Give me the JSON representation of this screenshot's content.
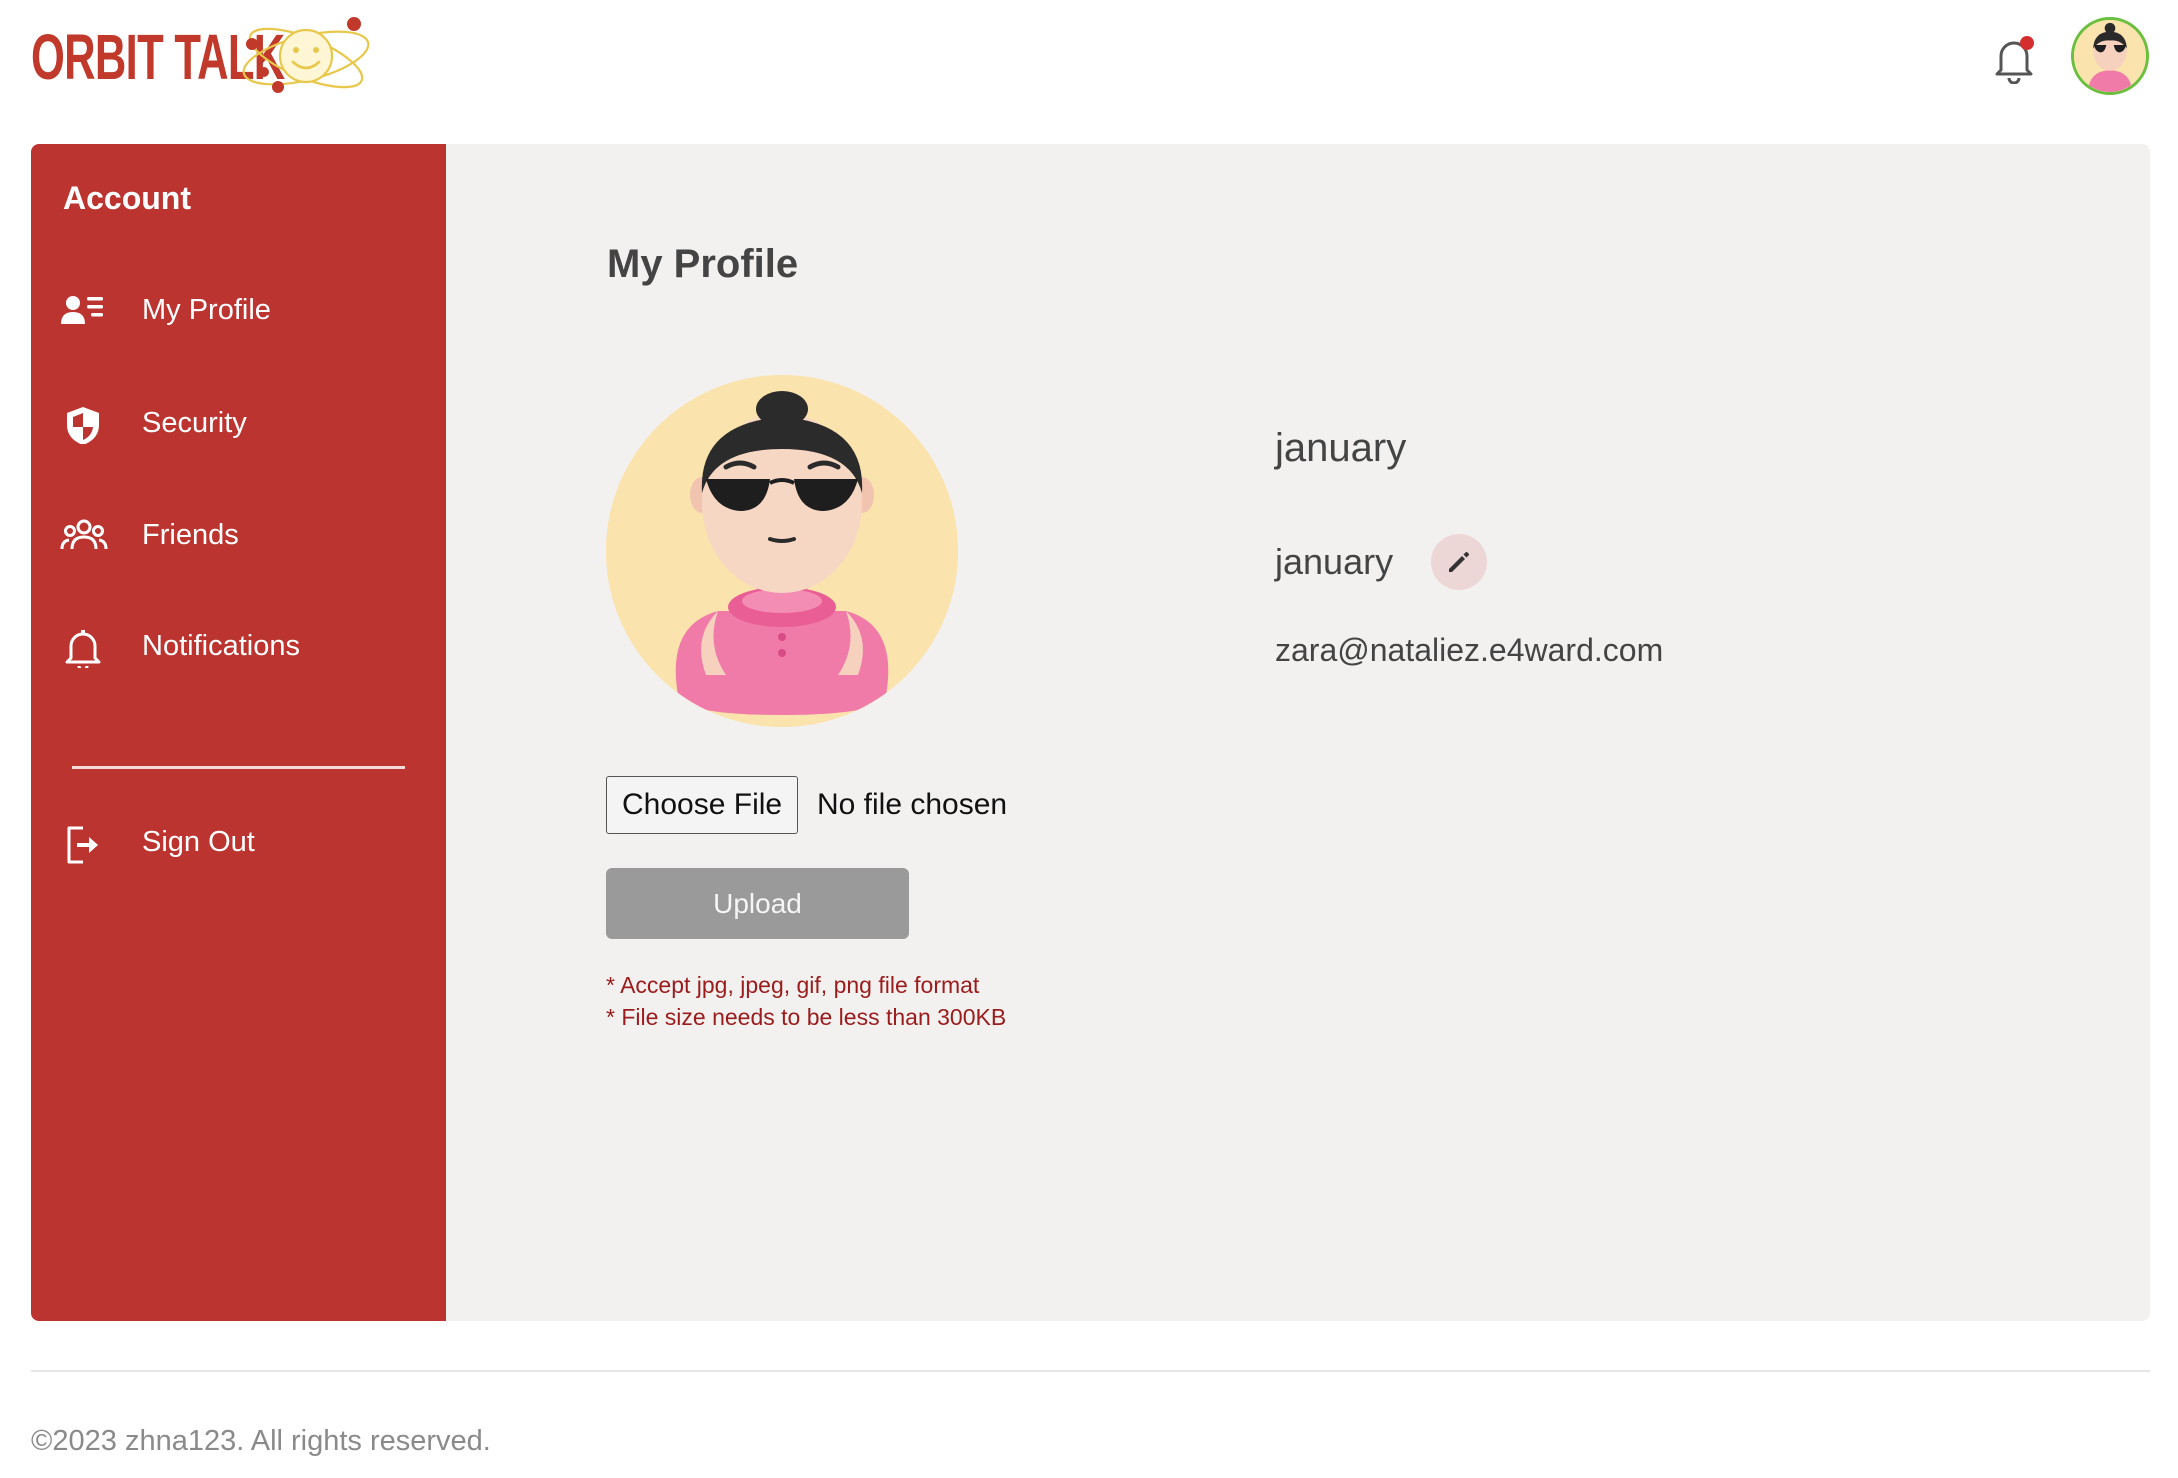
{
  "header": {
    "logo_text": "ORBIT TALK",
    "logo_icon": "smiley-planet-logo-icon",
    "bell_icon": "bell-icon",
    "avatar_icon": "user-avatar"
  },
  "sidebar": {
    "title": "Account",
    "items": [
      {
        "label": "My Profile",
        "icon": "user-list-icon"
      },
      {
        "label": "Security",
        "icon": "shield-icon"
      },
      {
        "label": "Friends",
        "icon": "group-icon"
      },
      {
        "label": "Notifications",
        "icon": "bell-icon"
      }
    ],
    "sign_out": {
      "label": "Sign Out",
      "icon": "sign-out-icon"
    }
  },
  "main": {
    "title": "My Profile",
    "file_input": {
      "button_label": "Choose File",
      "status": "No file chosen"
    },
    "upload_label": "Upload",
    "hints": [
      "* Accept jpg, jpeg, gif, png file format",
      "* File size needs to be less than 300KB"
    ]
  },
  "profile": {
    "display_name": "january",
    "username": "january",
    "email": "zara@nataliez.e4ward.com",
    "edit_icon": "pencil-icon"
  },
  "footer": {
    "copyright": "©2023 zhna123. All rights reserved."
  },
  "colors": {
    "brand_red": "#BC3430",
    "logo_red": "#C0392B",
    "content_bg": "#F2F1F0",
    "upload_disabled": "#9A9A9A",
    "hint_text": "#9B1C1C",
    "avatar_bg": "#FBE3AE",
    "notification_dot": "#D32F2F"
  }
}
